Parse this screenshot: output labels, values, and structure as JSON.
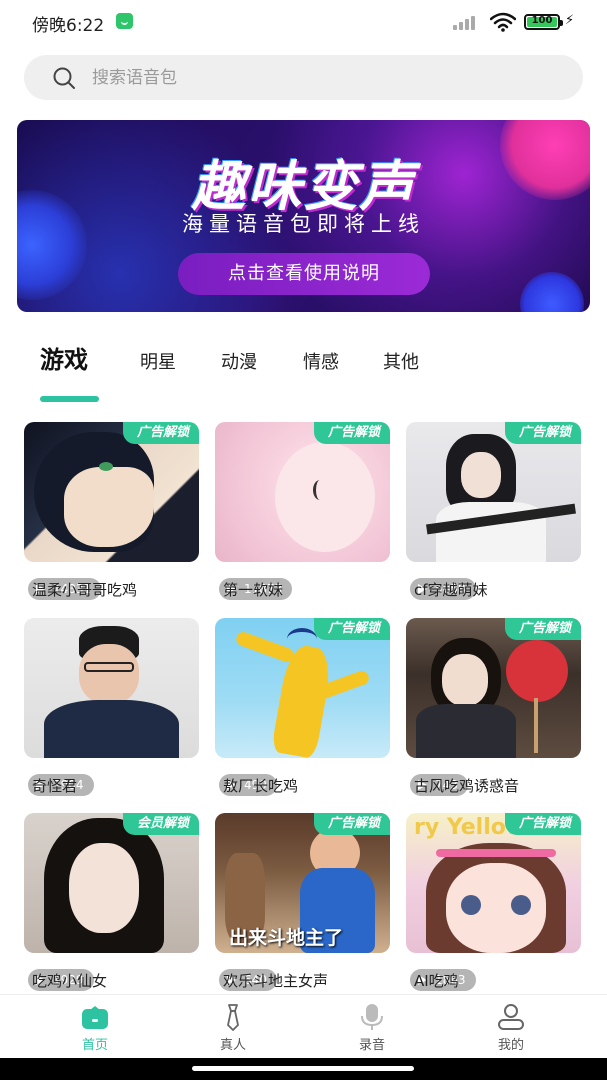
{
  "status_bar": {
    "time": "傍晚6:22",
    "battery": "100",
    "battery_level": 1.0
  },
  "search": {
    "placeholder": "搜索语音包",
    "value": ""
  },
  "banner": {
    "title": "趣味变声",
    "subtitle": "海量语音包即将上线",
    "button_label": "点击查看使用说明"
  },
  "tabs": [
    {
      "label": "游戏",
      "active": true
    },
    {
      "label": "明星",
      "active": false
    },
    {
      "label": "动漫",
      "active": false
    },
    {
      "label": "情感",
      "active": false
    },
    {
      "label": "其他",
      "active": false
    }
  ],
  "cards": [
    {
      "title": "温柔小哥哥吃鸡",
      "plays": "14831",
      "badge": "广告解锁"
    },
    {
      "title": "第一软妹",
      "plays": "11873",
      "badge": "广告解锁"
    },
    {
      "title": "cf穿越萌妹",
      "plays": "5058",
      "badge": "广告解锁"
    },
    {
      "title": "奇怪君",
      "plays": "7904",
      "badge": ""
    },
    {
      "title": "敖厂长吃鸡",
      "plays": "499",
      "badge": "广告解锁"
    },
    {
      "title": "古风吃鸡诱惑音",
      "plays": "743",
      "badge": "广告解锁"
    },
    {
      "title": "吃鸡小仙女",
      "plays": "1929",
      "badge": "会员解锁"
    },
    {
      "title": "欢乐斗地主女声",
      "plays": "640",
      "badge": "广告解锁",
      "thumb_caption": "出来斗地主了"
    },
    {
      "title": "AI吃鸡",
      "plays": "1863",
      "badge": "广告解锁",
      "thumb_caption": "ry Yellow"
    }
  ],
  "bottom_nav": [
    {
      "label": "首页",
      "icon": "home-icon",
      "active": true
    },
    {
      "label": "真人",
      "icon": "tie-icon",
      "active": false
    },
    {
      "label": "录音",
      "icon": "microphone-icon",
      "active": false
    },
    {
      "label": "我的",
      "icon": "user-icon",
      "active": false
    }
  ],
  "colors": {
    "accent": "#2dc2a0",
    "badge": "#2fc795",
    "banner_button": "#8a22cc"
  }
}
